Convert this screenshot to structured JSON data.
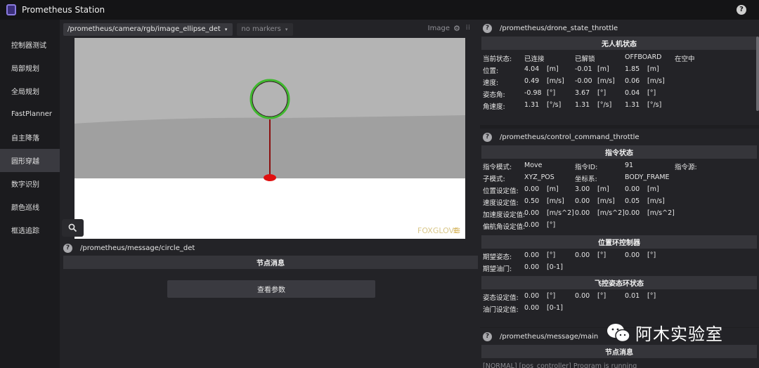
{
  "app": {
    "title": "Prometheus Station",
    "help": "?"
  },
  "sidebar": {
    "items": [
      {
        "label": "控制器测试"
      },
      {
        "label": "局部规划"
      },
      {
        "label": "全局规划"
      },
      {
        "label": "FastPlanner"
      },
      {
        "label": "自主降落"
      },
      {
        "label": "圆形穿越"
      },
      {
        "label": "数字识别"
      },
      {
        "label": "颜色巡线"
      },
      {
        "label": "框选追踪"
      }
    ],
    "active_index": 5
  },
  "image_panel": {
    "topic": "/prometheus/camera/rgb/image_ellipse_det",
    "markers": "no markers",
    "label": "Image",
    "caret": "▾",
    "watermark": "FOXGLOVE",
    "watermark_mark": "≋",
    "zoom_icon": "search-icon"
  },
  "circle_panel": {
    "help": "?",
    "topic": "/prometheus/message/circle_det",
    "section": "节点消息",
    "button": "查看参数"
  },
  "drone_state": {
    "help": "?",
    "topic": "/prometheus/drone_state_throttle",
    "section": "无人机状态",
    "rows": [
      [
        "当前状态:",
        "已连接",
        "",
        "已解锁",
        "",
        "OFFBOARD",
        "",
        "在空中",
        ""
      ],
      [
        "位置:",
        "4.04",
        "[m]",
        "-0.01",
        "[m]",
        "1.85",
        "[m]",
        "",
        ""
      ],
      [
        "速度:",
        "0.49",
        "[m/s]",
        "-0.00",
        "[m/s]",
        "0.06",
        "[m/s]",
        "",
        ""
      ],
      [
        "姿态角:",
        "-0.98",
        "[°]",
        "3.67",
        "[°]",
        "0.04",
        "[°]",
        "",
        ""
      ],
      [
        "角速度:",
        "1.31",
        "[°/s]",
        "1.31",
        "[°/s]",
        "1.31",
        "[°/s]",
        "",
        ""
      ]
    ]
  },
  "control_command": {
    "help": "?",
    "topic": "/prometheus/control_command_throttle",
    "section": "指令状态",
    "rows": [
      [
        "指令模式:",
        "Move",
        "",
        "指令ID:",
        "",
        "91",
        "",
        "指令源:",
        ""
      ],
      [
        "子模式:",
        "XYZ_POS",
        "",
        "坐标系:",
        "",
        "BODY_FRAME",
        "",
        "",
        ""
      ],
      [
        "位置设定值:",
        "0.00",
        "[m]",
        "3.00",
        "[m]",
        "0.00",
        "[m]",
        "",
        ""
      ],
      [
        "速度设定值:",
        "0.50",
        "[m/s]",
        "0.00",
        "[m/s]",
        "0.05",
        "[m/s]",
        "",
        ""
      ],
      [
        "加速度设定值:",
        "0.00",
        "[m/s^2]",
        "0.00",
        "[m/s^2]",
        "0.00",
        "[m/s^2]",
        "",
        ""
      ],
      [
        "偏航角设定值:",
        "0.00",
        "[°]",
        "",
        "",
        "",
        "",
        "",
        ""
      ]
    ],
    "section2": "位置环控制器",
    "rows2": [
      [
        "期望姿态:",
        "0.00",
        "[°]",
        "0.00",
        "[°]",
        "0.00",
        "[°]",
        "",
        ""
      ],
      [
        "期望油门:",
        "0.00",
        "[0-1]",
        "",
        "",
        "",
        "",
        "",
        ""
      ]
    ],
    "section3": "飞控姿态环状态",
    "rows3": [
      [
        "姿态设定值:",
        "0.00",
        "[°]",
        "0.00",
        "[°]",
        "0.01",
        "[°]",
        "",
        ""
      ],
      [
        "油门设定值:",
        "0.00",
        "[0-1]",
        "",
        "",
        "",
        "",
        "",
        ""
      ]
    ]
  },
  "main_message": {
    "help": "?",
    "topic": "/prometheus/message/main",
    "section": "节点消息",
    "log": "[NORMAL]    [pos_controller] Program is running"
  },
  "watermark": {
    "text": "阿木实验室",
    "icon": "wechat-icon"
  },
  "colors": {
    "bg": "#232327",
    "titlebar": "#141416",
    "sidebar": "#1b1b1e",
    "active": "#3a3a40",
    "section": "#35353a",
    "circle": "#3fb82e",
    "pole": "#8a1010",
    "target": "#e01010"
  }
}
